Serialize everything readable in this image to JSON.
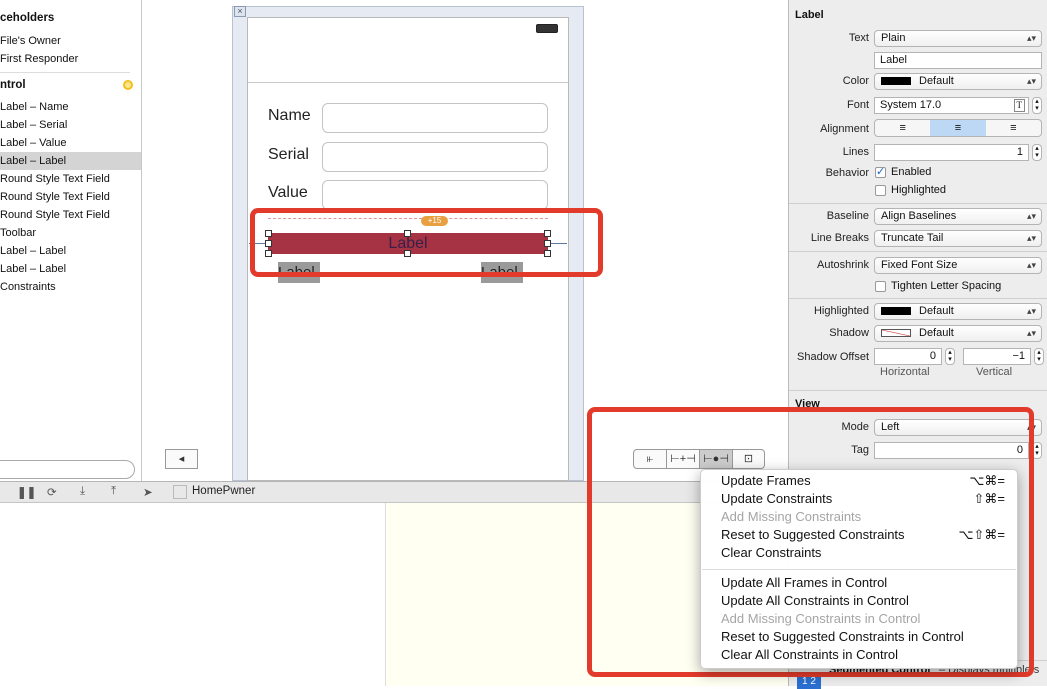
{
  "navigator": {
    "sections": [
      {
        "title": "ceholders"
      },
      {
        "title": "ntrol"
      }
    ],
    "placeholders": [
      "File's Owner",
      "First Responder"
    ],
    "items": [
      "Label – Name",
      "Label – Serial",
      "Label – Value",
      "Label – Label",
      "Round Style Text Field",
      "Round Style Text Field",
      "Round Style Text Field",
      "Toolbar",
      "Label – Label",
      "Label – Label",
      "Constraints"
    ],
    "selected_index": 3,
    "warning_color": "#f0c020"
  },
  "canvas": {
    "fields": [
      {
        "label": "Name"
      },
      {
        "label": "Serial"
      },
      {
        "label": "Value"
      }
    ],
    "selected_label": "Label",
    "selected_label_color": "#a63343",
    "constraint_badge": "+15",
    "small_labels": [
      "Label",
      "Label"
    ],
    "annotation_color": "#e23b2c",
    "bottom_buttons": [
      "align-icon",
      "pin-icon",
      "resolve-issues-icon",
      "resizing-icon"
    ]
  },
  "debug_bar": {
    "target": "HomePwner",
    "icons": [
      "pause-icon",
      "step-over-icon",
      "step-into-icon",
      "step-out-icon",
      "location-icon"
    ]
  },
  "inspector": {
    "section_label": "Label",
    "text_type": "Plain",
    "text_value": "Label",
    "color": "Default",
    "font": "System 17.0",
    "alignment": [
      "left",
      "center",
      "right"
    ],
    "alignment_selected": "center",
    "lines": "1",
    "behavior_enabled": true,
    "behavior_enabled_label": "Enabled",
    "behavior_highlighted": false,
    "behavior_highlighted_label": "Highlighted",
    "baseline": "Align Baselines",
    "line_breaks": "Truncate Tail",
    "autoshrink": "Fixed Font Size",
    "tighten_label": "Tighten Letter Spacing",
    "tighten": false,
    "highlighted": "Default",
    "shadow": "Default",
    "shadow_offset_h": "0",
    "shadow_offset_v": "−1",
    "labels": {
      "text": "Text",
      "color": "Color",
      "font": "Font",
      "alignment": "Alignment",
      "lines": "Lines",
      "behavior": "Behavior",
      "baseline": "Baseline",
      "line_breaks": "Line Breaks",
      "autoshrink": "Autoshrink",
      "highlighted": "Highlighted",
      "shadow": "Shadow",
      "shadow_offset": "Shadow Offset",
      "horizontal": "Horizontal",
      "vertical": "Vertical",
      "mode": "Mode",
      "tag": "Tag"
    },
    "view_section": "View",
    "mode": "Left",
    "tag": "0",
    "library_item_title": "Segmented Control",
    "library_item_desc": "– Displays multiple segments, each of which"
  },
  "menu": {
    "group1": [
      {
        "label": "Update Frames",
        "shortcut": "⌥⌘=",
        "enabled": true
      },
      {
        "label": "Update Constraints",
        "shortcut": "⇧⌘=",
        "enabled": true
      },
      {
        "label": "Add Missing Constraints",
        "shortcut": "",
        "enabled": false
      },
      {
        "label": "Reset to Suggested Constraints",
        "shortcut": "⌥⇧⌘=",
        "enabled": true
      },
      {
        "label": "Clear Constraints",
        "shortcut": "",
        "enabled": true
      }
    ],
    "group2": [
      {
        "label": "Update All Frames in Control",
        "enabled": true
      },
      {
        "label": "Update All Constraints in Control",
        "enabled": true
      },
      {
        "label": "Add Missing Constraints in Control",
        "enabled": false
      },
      {
        "label": "Reset to Suggested Constraints in Control",
        "enabled": true
      },
      {
        "label": "Clear All Constraints in Control",
        "enabled": true
      }
    ]
  }
}
